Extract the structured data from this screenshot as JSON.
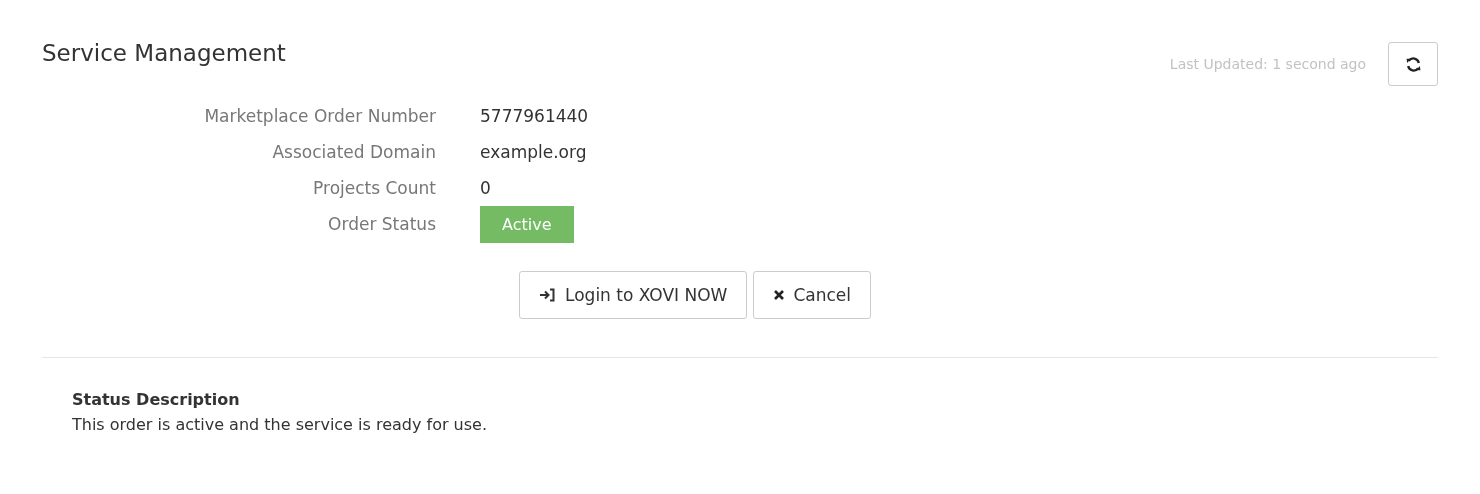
{
  "header": {
    "title": "Service Management",
    "last_updated": "Last Updated: 1 second ago"
  },
  "fields": [
    {
      "label": "Marketplace Order Number",
      "value": "5777961440",
      "kind": "text"
    },
    {
      "label": "Associated Domain",
      "value": "example.org",
      "kind": "text"
    },
    {
      "label": "Projects Count",
      "value": "0",
      "kind": "text"
    },
    {
      "label": "Order Status",
      "value": "Active",
      "kind": "badge",
      "color": "#74bb64"
    }
  ],
  "buttons": [
    {
      "label": "Login to XOVI NOW",
      "kind": "login"
    },
    {
      "label": "Cancel",
      "kind": "cancel"
    }
  ],
  "status_description": {
    "title": "Status Description",
    "text": "This order is active and the service is ready for use."
  }
}
